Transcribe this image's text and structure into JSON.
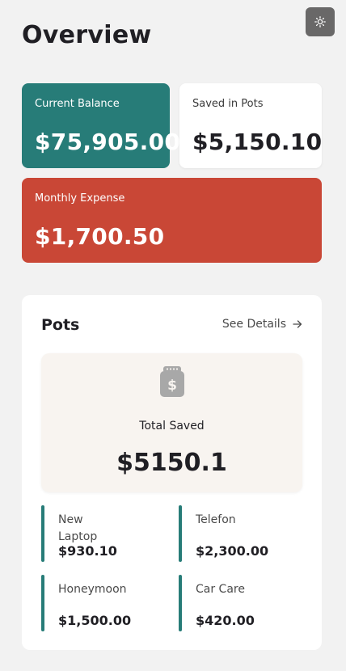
{
  "header": {
    "title": "Overview",
    "theme_toggle_icon": "sun-icon"
  },
  "summary": {
    "balance": {
      "label": "Current Balance",
      "value": "$75,905.00",
      "color": "#277c78"
    },
    "saved": {
      "label": "Saved in Pots",
      "value": "$5,150.10"
    },
    "expense": {
      "label": "Monthly Expense",
      "value": "$1,700.50",
      "color": "#c94736"
    }
  },
  "pots": {
    "title": "Pots",
    "see_details": "See Details",
    "see_details_icon": "arrow-right-icon",
    "total_icon": "money-jar-icon",
    "total_label": "Total Saved",
    "total_value": "$5150.1",
    "items": [
      {
        "name": "New Laptop",
        "amount": "$930.10",
        "color": "#277c78"
      },
      {
        "name": "Telefon",
        "amount": "$2,300.00",
        "color": "#277c78"
      },
      {
        "name": "Honeymoon",
        "amount": "$1,500.00",
        "color": "#277c78"
      },
      {
        "name": "Car Care",
        "amount": "$420.00",
        "color": "#277c78"
      }
    ]
  }
}
